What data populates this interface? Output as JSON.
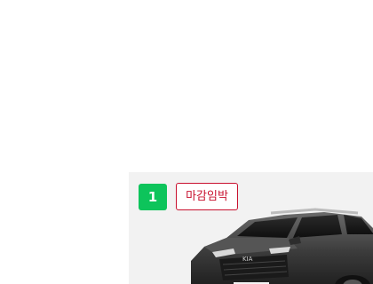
{
  "product_card": {
    "rank": "1",
    "tag": "마감임박",
    "image_icon": "suv-car-photo"
  },
  "colors": {
    "rank_badge": "#0dc45b",
    "tag_border": "#c8102e",
    "card_background": "#f2f2f2"
  }
}
